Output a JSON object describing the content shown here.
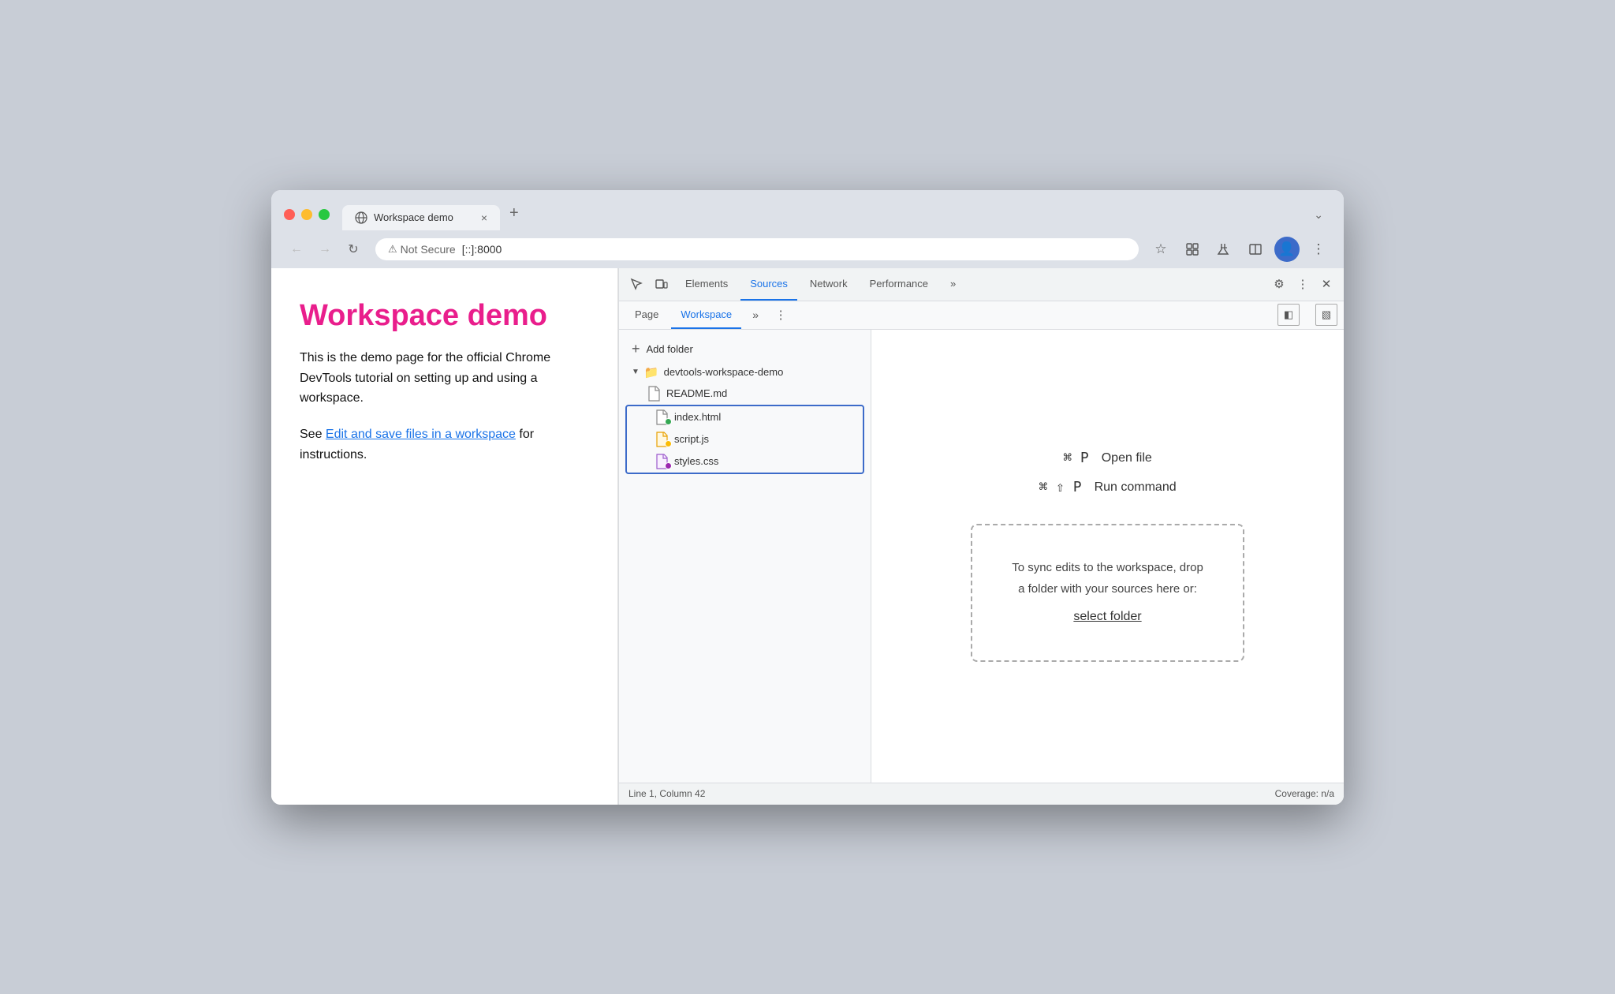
{
  "browser": {
    "tab_title": "Workspace demo",
    "tab_close": "×",
    "new_tab": "+",
    "tab_expand": "⌄",
    "not_secure_label": "Not Secure",
    "address": "[::]:8000",
    "back_arrow": "←",
    "forward_arrow": "→",
    "reload": "↻"
  },
  "page": {
    "title": "Workspace demo",
    "description": "This is the demo page for the official Chrome DevTools tutorial on setting up and using a workspace.",
    "see_label": "See ",
    "link_text": "Edit and save files in a workspace",
    "for_label": " for instructions."
  },
  "devtools": {
    "tabs": [
      {
        "label": "Elements",
        "active": false
      },
      {
        "label": "Sources",
        "active": true
      },
      {
        "label": "Network",
        "active": false
      },
      {
        "label": "Performance",
        "active": false
      }
    ],
    "more_tabs": "»",
    "subtabs": [
      {
        "label": "Page",
        "active": false
      },
      {
        "label": "Workspace",
        "active": true
      }
    ],
    "add_folder_label": "+ Add folder",
    "folder_name": "devtools-workspace-demo",
    "files": [
      {
        "name": "README.md",
        "dot": null
      },
      {
        "name": "index.html",
        "dot": "green"
      },
      {
        "name": "script.js",
        "dot": "orange"
      },
      {
        "name": "styles.css",
        "dot": "purple"
      }
    ],
    "shortcut1_keys": "⌘ P",
    "shortcut1_label": "Open file",
    "shortcut2_keys": "⌘ ⇧ P",
    "shortcut2_label": "Run command",
    "drop_zone_line1": "To sync edits to the workspace, drop",
    "drop_zone_line2": "a folder with your sources here or:",
    "select_folder": "select folder",
    "status_left": "Line 1, Column 42",
    "status_right": "Coverage: n/a"
  }
}
